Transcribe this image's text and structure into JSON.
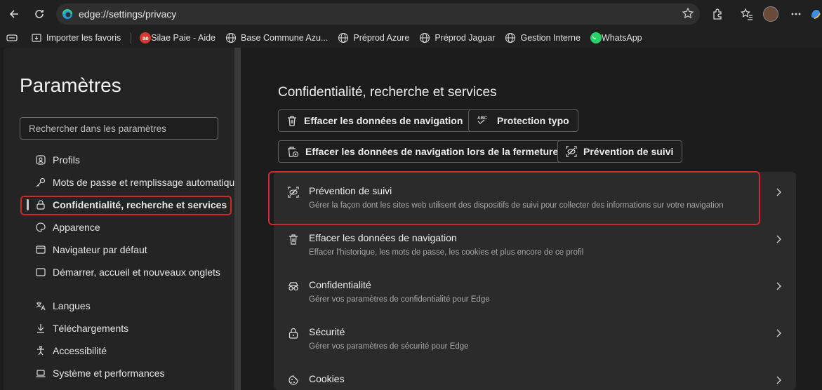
{
  "browser": {
    "url": "edge://settings/privacy"
  },
  "favorites": [
    {
      "label": "Importer les favoris",
      "icon": "import-favorites-icon"
    },
    {
      "label": "Silae Paie - Aide",
      "icon": "ae-logo-icon"
    },
    {
      "label": "Base Commune Azu...",
      "icon": "globe-icon"
    },
    {
      "label": "Préprod Azure",
      "icon": "globe-icon"
    },
    {
      "label": "Préprod Jaguar",
      "icon": "globe-icon"
    },
    {
      "label": "Gestion Interne",
      "icon": "globe-icon"
    },
    {
      "label": "WhatsApp",
      "icon": "whatsapp-icon"
    }
  ],
  "sidebar": {
    "title": "Paramètres",
    "search_placeholder": "Rechercher dans les paramètres",
    "items": [
      {
        "label": "Profils",
        "icon": "profile-icon"
      },
      {
        "label": "Mots de passe et remplissage automatique",
        "icon": "key-icon"
      },
      {
        "label": "Confidentialité, recherche et services",
        "icon": "lock-icon",
        "active": true
      },
      {
        "label": "Apparence",
        "icon": "palette-icon"
      },
      {
        "label": "Navigateur par défaut",
        "icon": "browser-icon"
      },
      {
        "label": "Démarrer, accueil et nouveaux onglets",
        "icon": "home-icon"
      },
      {
        "label": "Langues",
        "icon": "language-icon"
      },
      {
        "label": "Téléchargements",
        "icon": "download-icon"
      },
      {
        "label": "Accessibilité",
        "icon": "accessibility-icon"
      },
      {
        "label": "Système et performances",
        "icon": "laptop-icon"
      }
    ]
  },
  "main": {
    "title": "Confidentialité, recherche et services",
    "quick_buttons": [
      {
        "label": "Effacer les données de navigation",
        "icon": "trash-icon"
      },
      {
        "label": "Protection typo",
        "icon": "abc-check-icon"
      },
      {
        "label": "Effacer les données de navigation lors de la fermeture",
        "icon": "trash-clock-icon"
      },
      {
        "label": "Prévention de suivi",
        "icon": "tracking-prevention-icon"
      }
    ],
    "sections": [
      {
        "title": "Prévention de suivi",
        "desc": "Gérer la façon dont les sites web utilisent des dispositifs de suivi pour collecter des informations sur votre navigation",
        "icon": "tracking-prevention-icon"
      },
      {
        "title": "Effacer les données de navigation",
        "desc": "Effacer l'historique, les mots de passe, les cookies et plus encore de ce profil",
        "icon": "trash-icon"
      },
      {
        "title": "Confidentialité",
        "desc": "Gérer vos paramètres de confidentialité pour Edge",
        "icon": "incognito-glasses-icon"
      },
      {
        "title": "Sécurité",
        "desc": "Gérer vos paramètres de sécurité pour Edge",
        "icon": "lock-icon"
      },
      {
        "title": "Cookies",
        "desc": "",
        "icon": "cookie-icon"
      }
    ]
  }
}
